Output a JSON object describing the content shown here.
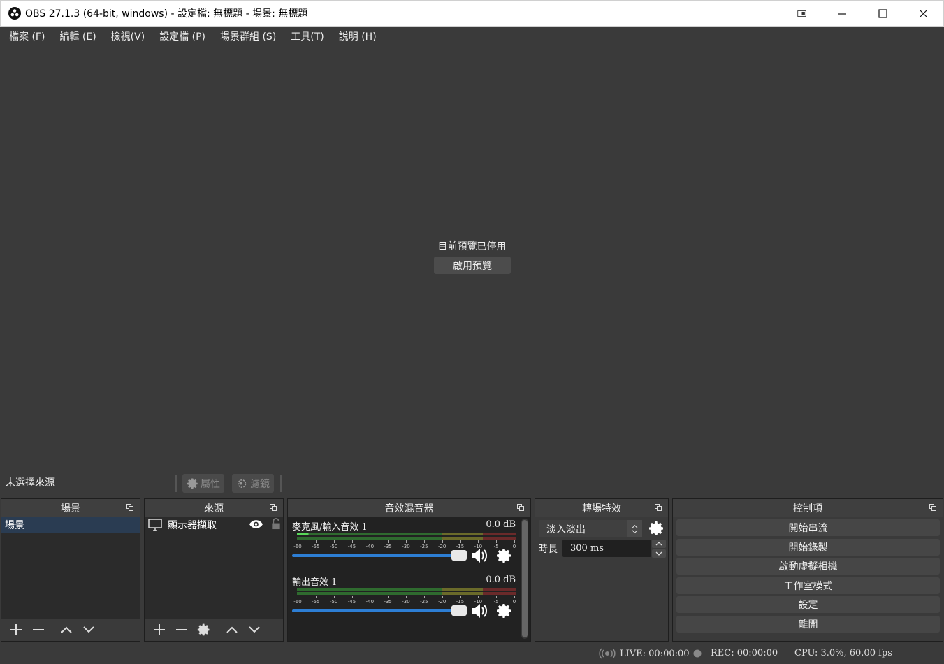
{
  "window": {
    "title": "OBS 27.1.3 (64-bit, windows) - 設定檔: 無標題 - 場景: 無標題",
    "minimize": "—",
    "maximize": "☐",
    "close": "✕"
  },
  "menu": [
    "檔案 (F)",
    "編輯 (E)",
    "檢視(V)",
    "設定檔 (P)",
    "場景群組 (S)",
    "工具(T)",
    "說明 (H)"
  ],
  "preview": {
    "message": "目前預覽已停用",
    "enable_button": "啟用預覽"
  },
  "context": {
    "no_source": "未選擇來源",
    "properties": "屬性",
    "filters": "濾鏡"
  },
  "scenes": {
    "title": "場景",
    "items": [
      "場景"
    ]
  },
  "sources": {
    "title": "來源",
    "items": [
      "顯示器擷取"
    ]
  },
  "mixer": {
    "title": "音效混音器",
    "tracks": [
      {
        "name": "麥克風/輸入音效 1",
        "db": "0.0 dB",
        "level": 0.08,
        "volume": 1.0
      },
      {
        "name": "輸出音效 1",
        "db": "0.0 dB",
        "level": 0.0,
        "volume": 1.0
      }
    ],
    "ticks": [
      "-60",
      "-55",
      "-50",
      "-45",
      "-40",
      "-35",
      "-30",
      "-25",
      "-20",
      "-15",
      "-10",
      "-5",
      "0"
    ]
  },
  "transitions": {
    "title": "轉場特效",
    "selected": "淡入淡出",
    "duration_label": "時長",
    "duration_value": "300 ms"
  },
  "controls": {
    "title": "控制項",
    "buttons": [
      "開始串流",
      "開始錄製",
      "啟動虛擬相機",
      "工作室模式",
      "設定",
      "離開"
    ]
  },
  "status": {
    "live": "LIVE: 00:00:00",
    "rec": "REC: 00:00:00",
    "cpu": "CPU: 3.0%, 60.00 fps"
  }
}
